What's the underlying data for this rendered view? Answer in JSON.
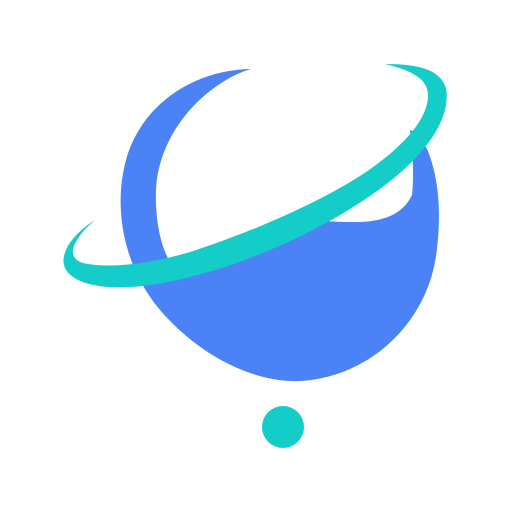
{
  "logo": {
    "icon": "planet-ring-logo-icon",
    "colors": {
      "planet": "#4b82f6",
      "ring": "#14cdc8",
      "dot": "#14cdc8",
      "background": "#ffffff"
    }
  }
}
